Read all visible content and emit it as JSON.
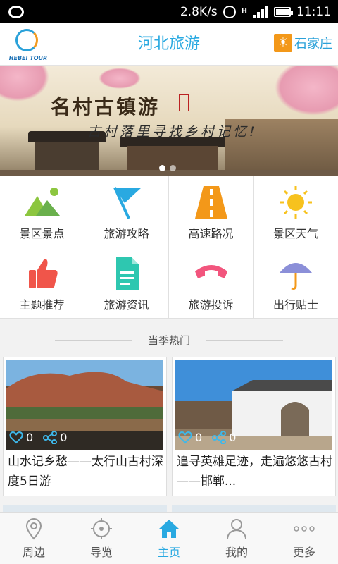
{
  "status_bar": {
    "network_speed": "2.8K/s",
    "network_type": "H",
    "time": "11:11"
  },
  "header": {
    "logo_text": "HEBEI TOUR",
    "title": "河北旅游",
    "city": "石家庄"
  },
  "banner": {
    "title": "名村古镇游",
    "subtitle": "古村落里寻找乡村记忆!",
    "slide_count": 2,
    "active_slide": 1
  },
  "grid": [
    {
      "label": "景区景点",
      "icon": "mountain-icon"
    },
    {
      "label": "旅游攻略",
      "icon": "flag-icon"
    },
    {
      "label": "高速路况",
      "icon": "road-icon"
    },
    {
      "label": "景区天气",
      "icon": "sun-icon"
    },
    {
      "label": "主题推荐",
      "icon": "thumbs-up-icon"
    },
    {
      "label": "旅游资讯",
      "icon": "document-icon"
    },
    {
      "label": "旅游投诉",
      "icon": "phone-icon"
    },
    {
      "label": "出行贴士",
      "icon": "umbrella-icon"
    }
  ],
  "section": {
    "title": "当季热门"
  },
  "cards": [
    {
      "title": "山水记乡愁——太行山古村深度5日游",
      "likes": "0",
      "shares": "0"
    },
    {
      "title": "追寻英雄足迹，走遍悠悠古村——邯郸...",
      "likes": "0",
      "shares": "0"
    }
  ],
  "tabs": [
    {
      "label": "周边",
      "icon": "location-pin-icon"
    },
    {
      "label": "导览",
      "icon": "compass-icon"
    },
    {
      "label": "主页",
      "icon": "home-icon",
      "active": true
    },
    {
      "label": "我的",
      "icon": "user-icon"
    },
    {
      "label": "更多",
      "icon": "more-dots-icon"
    }
  ],
  "colors": {
    "brand_blue": "#29a9e1",
    "accent_orange": "#f39819"
  }
}
